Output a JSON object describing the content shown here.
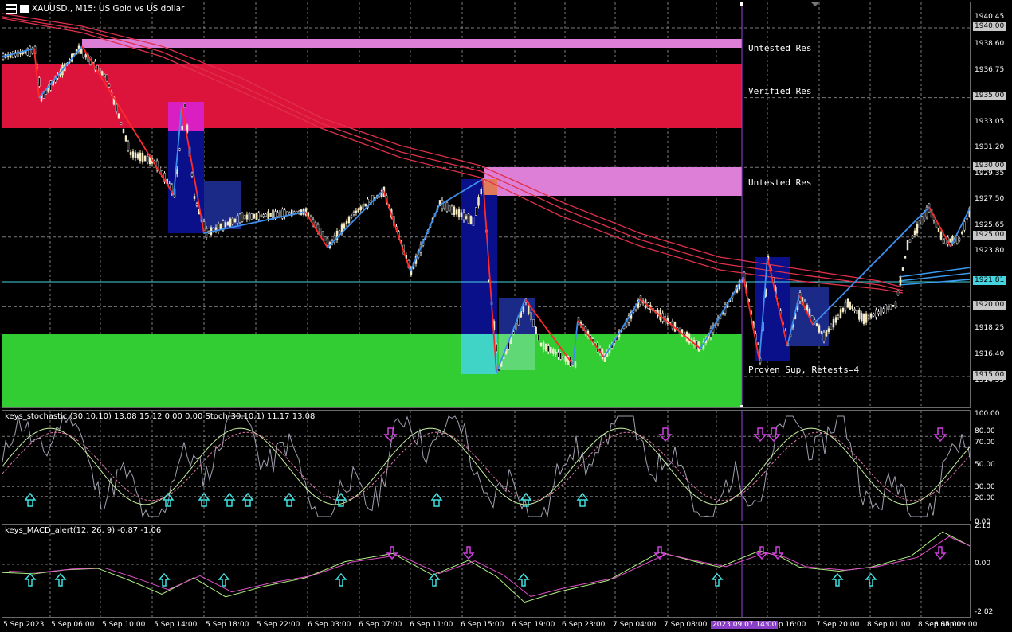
{
  "window": {
    "symbol_title": "XAUUSD., M15:  US Gold vs US dollar"
  },
  "icons": [
    "chart-menu-icon",
    "one-click-trading-icon"
  ],
  "zones": [
    {
      "label": "Untested Res",
      "color": "#dd7fd6"
    },
    {
      "label": "Verified Res",
      "color": "#dc143c"
    },
    {
      "label": "Untested Res",
      "color": "#dd7fd6"
    },
    {
      "label": "Proven Sup, Retests=4",
      "color": "#32cd32"
    }
  ],
  "price_axis": {
    "ticks": [
      "1940.45",
      "1938.60",
      "1936.75",
      "1933.05",
      "1931.20",
      "1929.35",
      "1927.50",
      "1925.65",
      "1923.80",
      "1918.25",
      "1916.40",
      "1914.55"
    ],
    "boxed": [
      "1940.00",
      "1935.00",
      "1930.00",
      "1925.00",
      "1920.00",
      "1915.00"
    ],
    "current": "1921.81"
  },
  "stoch_axis": [
    "100.00",
    "80.00",
    "70.00",
    "50.00",
    "30.00",
    "20.00",
    "0.00"
  ],
  "macd_axis": [
    "2.18",
    "0.00",
    "-2.82"
  ],
  "indicators": {
    "stoch_label": "keys_stochastic (30,10,10) 13.08 15.12 0.00 0.00 Stoch(30,10,1) 11.17 13.08",
    "macd_label": "keys_MACD_alert(12, 26, 9) -0.87 -1.06"
  },
  "time_axis": {
    "ticks": [
      "5 Sep 2023",
      "5 Sep 06:00",
      "5 Sep 10:00",
      "5 Sep 14:00",
      "5 Sep 18:00",
      "5 Sep 22:00",
      "6 Sep 03:00",
      "6 Sep 07:00",
      "6 Sep 11:00",
      "6 Sep 15:00",
      "6 Sep 19:00",
      "6 Sep 23:00",
      "7 Sep 04:00",
      "7 Sep 08:00",
      "7 Sep 16:00",
      "7 Sep 20:00",
      "8 Sep 01:00",
      "8 Sep 05:00",
      "8 Sep 09:00"
    ],
    "crosshair": "2023.09.07 14:00"
  },
  "colors": {
    "background": "#000000",
    "bull_candle": "#f2e6b0",
    "zigzag_up": "#3d8fef",
    "zigzag_down": "#ff2a2a",
    "ma_lines": "#e0304a",
    "stoch_main": "#a0a0b0",
    "crosshair": "#9a3fdf"
  }
}
